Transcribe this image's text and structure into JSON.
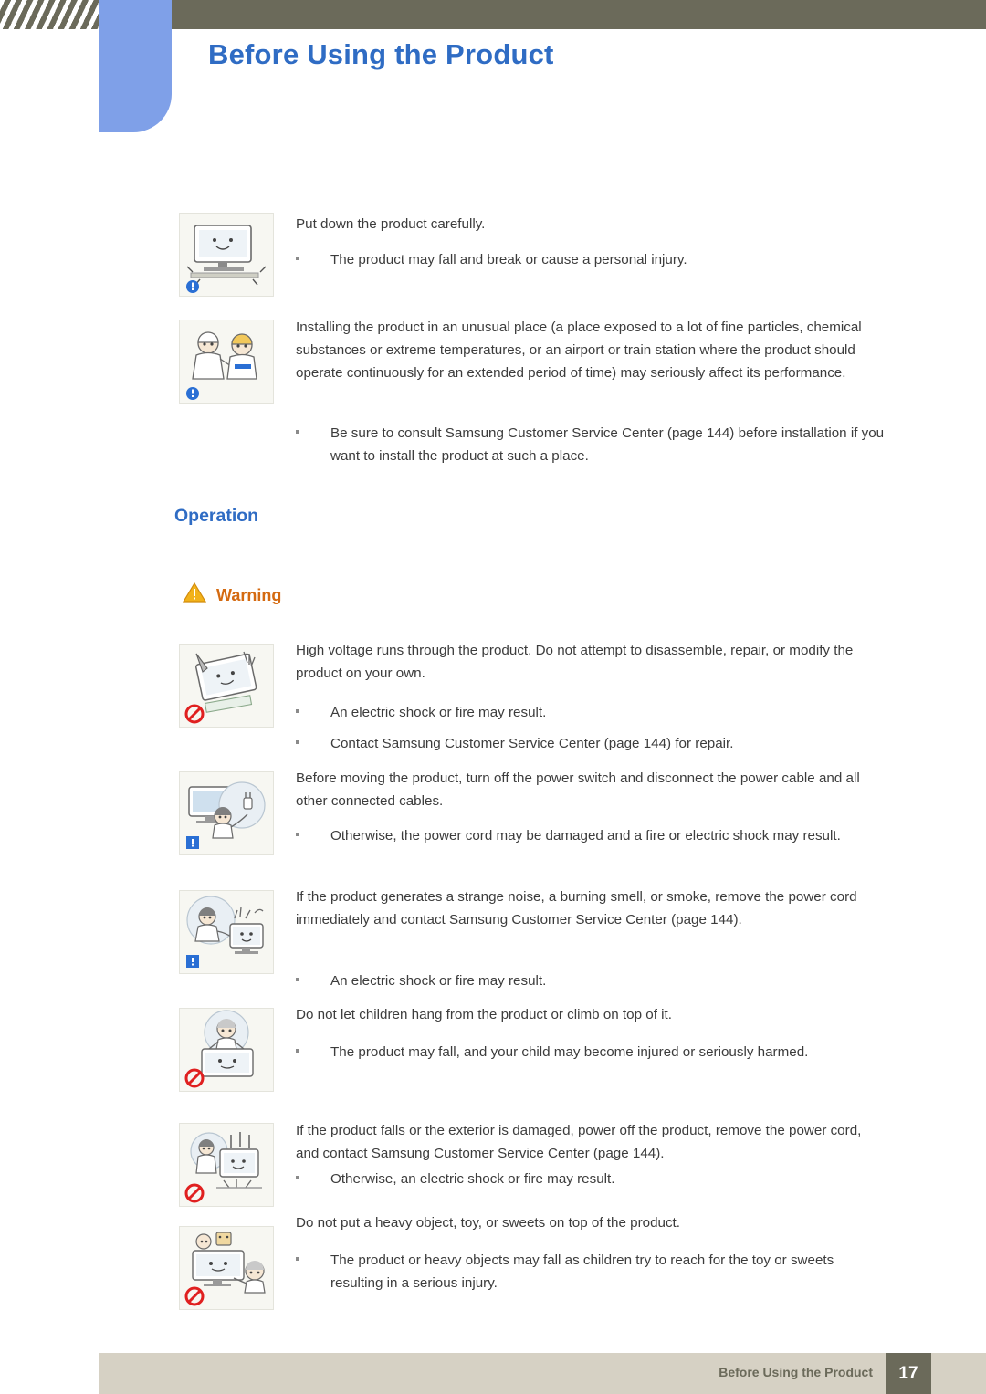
{
  "header": {
    "title": "Before Using the Product"
  },
  "sections": [
    {
      "id": "caution-items",
      "items": [
        {
          "icon": "monitor-place-down-icon",
          "paragraph": "Put down the product carefully.",
          "bullets": [
            "The product may fall and break or cause a personal injury."
          ]
        },
        {
          "icon": "workers-unusual-place-icon",
          "paragraph": "Installing the product in an unusual place (a place exposed to a lot of fine particles, chemical substances or extreme temperatures, or an airport or train station where the product should operate continuously for an extended period of time) may seriously affect its performance.",
          "bullets": [
            "Be sure to consult Samsung Customer Service Center (page 144) before installation if you want to install the product at such a place."
          ]
        }
      ]
    }
  ],
  "operation": {
    "heading": "Operation",
    "warning_label": "Warning",
    "warning_icon": "warning-triangle-icon",
    "items": [
      {
        "icon": "no-disassemble-icon",
        "paragraph": "High voltage runs through the product. Do not attempt to disassemble, repair, or modify the product on your own.",
        "bullets": [
          "An electric shock or fire may result.",
          "Contact Samsung Customer Service Center (page 144) for repair."
        ]
      },
      {
        "icon": "unplug-before-moving-icon",
        "paragraph": "Before moving the product, turn off the power switch and disconnect the power cable and all other connected cables.",
        "bullets": [
          "Otherwise, the power cord may be damaged and a fire or electric shock may result."
        ]
      },
      {
        "icon": "strange-noise-smoke-icon",
        "paragraph": "If the product generates a strange noise, a burning smell, or smoke, remove the power cord immediately and contact Samsung Customer Service Center (page 144).",
        "bullets": [
          "An electric shock or fire may result."
        ]
      },
      {
        "icon": "no-children-hanging-icon",
        "paragraph": "Do not let children hang from the product or climb on top of it.",
        "bullets": [
          "The product may fall, and your child may become injured or seriously harmed."
        ]
      },
      {
        "icon": "product-falls-damaged-icon",
        "paragraph": "If the product falls or the exterior is damaged, power off the product, remove the power cord, and contact Samsung Customer Service Center (page 144).",
        "bullets": [
          "Otherwise, an electric shock or fire may result."
        ]
      },
      {
        "icon": "no-heavy-object-on-top-icon",
        "paragraph": "Do not put a heavy object, toy, or sweets on top of the product.",
        "bullets": [
          "The product or heavy objects may fall as children try to reach for the toy or sweets resulting in a serious injury."
        ]
      }
    ]
  },
  "footer": {
    "text": "Before Using the Product",
    "page": "17"
  },
  "colors": {
    "header_band": "#6b6a5a",
    "blue_tab": "#7fa0e8",
    "title_blue": "#2f6cc4",
    "warning_orange": "#d46a11",
    "footer_band": "#d6d1c4",
    "figure_bg": "#f7f7f2"
  }
}
